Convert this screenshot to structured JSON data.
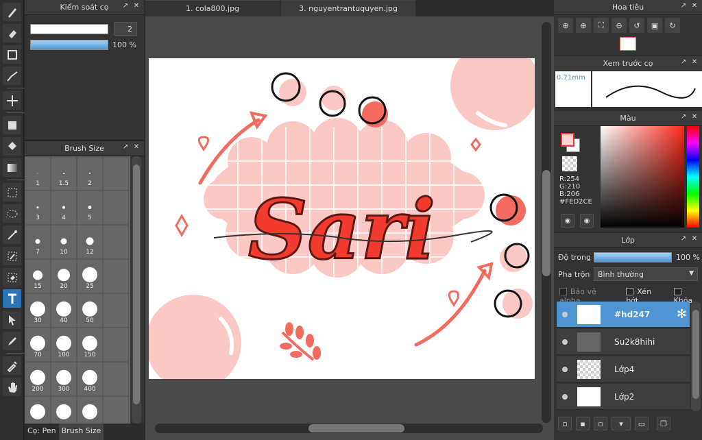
{
  "doc_tabs": [
    "1. cola800.jpg",
    "3. nguyentrantuquyen.jpg"
  ],
  "brush_control": {
    "title": "Kiểm soát cọ",
    "size_value": "2",
    "opacity_value": "100 %"
  },
  "brush_size": {
    "title": "Brush Size",
    "cells": [
      "1",
      "1.5",
      "2",
      "",
      "3",
      "4",
      "5",
      "",
      "7",
      "10",
      "12",
      "",
      "15",
      "20",
      "25",
      "",
      "30",
      "40",
      "50",
      "",
      "70",
      "100",
      "150",
      "",
      "200",
      "300",
      "400",
      "",
      "",
      "",
      "",
      ""
    ]
  },
  "bottom_tabs": [
    "Cọ: Pen",
    "Brush Size"
  ],
  "navigator": {
    "title": "Hoa tiêu"
  },
  "brush_preview": {
    "title": "Xem trước cọ",
    "size": "0.71mm"
  },
  "color": {
    "title": "Màu",
    "r": "R:254",
    "g": "G:210",
    "b": "B:206",
    "hex": "#FED2CE",
    "fg": "#FED2CE"
  },
  "layers": {
    "title": "Lớp",
    "opacity_label": "Độ trong",
    "opacity_value": "100 %",
    "blend_label": "Pha trộn",
    "blend_value": "Bình thường",
    "protect_alpha": "Bảo vệ alpha",
    "clipping": "Xén bớt",
    "lock": "Khóa",
    "items": [
      "#hd247",
      "Su2k8hihi",
      "Lớp4",
      "Lớp2"
    ]
  },
  "artwork": {
    "text": "Sari"
  }
}
